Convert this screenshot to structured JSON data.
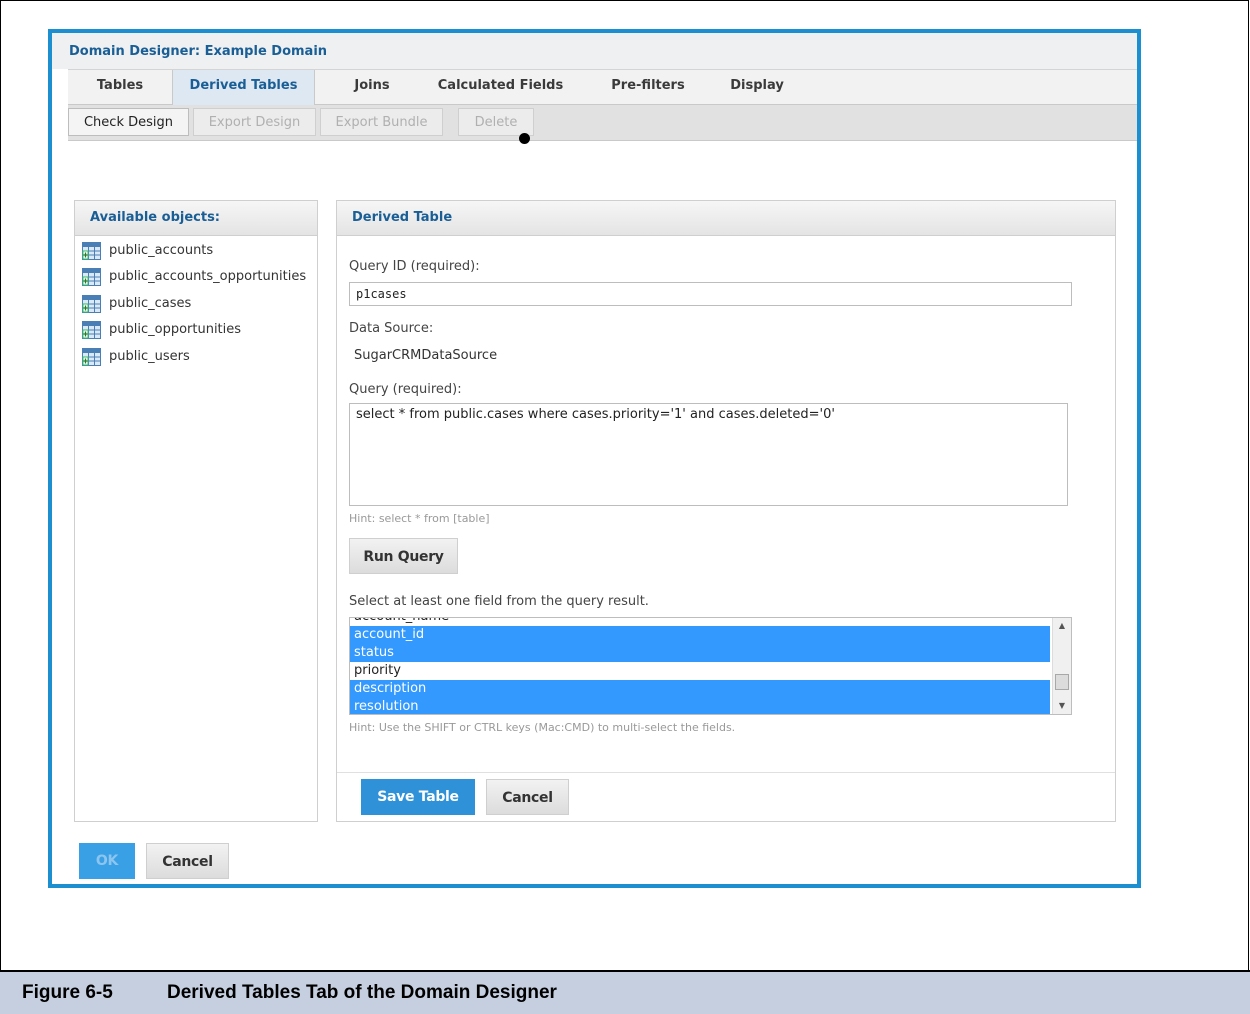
{
  "dialog": {
    "title": "Domain Designer: Example Domain"
  },
  "tabs": [
    {
      "label": "Tables"
    },
    {
      "label": "Derived Tables"
    },
    {
      "label": "Joins"
    },
    {
      "label": "Calculated Fields"
    },
    {
      "label": "Pre-filters"
    },
    {
      "label": "Display"
    }
  ],
  "active_tab": "Derived Tables",
  "toolbar": {
    "check_design": "Check Design",
    "export_design": "Export Design",
    "export_bundle": "Export Bundle",
    "delete": "Delete"
  },
  "available_objects": {
    "header": "Available objects:",
    "items": [
      "public_accounts",
      "public_accounts_opportunities",
      "public_cases",
      "public_opportunities",
      "public_users"
    ]
  },
  "derived_table": {
    "header": "Derived Table",
    "query_id_label": "Query ID (required):",
    "query_id_value": "p1cases",
    "data_source_label": "Data Source:",
    "data_source_value": "SugarCRMDataSource",
    "query_label": "Query (required):",
    "query_value": "select * from public.cases where cases.priority='1' and cases.deleted='0'",
    "query_hint": "Hint: select * from [table]",
    "run_query": "Run Query",
    "select_label": "Select at least one field from the query result.",
    "fields": [
      {
        "name": "account_name",
        "selected": false
      },
      {
        "name": "account_id",
        "selected": true
      },
      {
        "name": "status",
        "selected": true
      },
      {
        "name": "priority",
        "selected": false
      },
      {
        "name": "description",
        "selected": true
      },
      {
        "name": "resolution",
        "selected": true
      }
    ],
    "multi_hint": "Hint: Use the SHIFT or CTRL keys (Mac:CMD) to multi-select the fields.",
    "save_table": "Save Table",
    "cancel": "Cancel"
  },
  "footer": {
    "ok": "OK",
    "cancel": "Cancel"
  },
  "caption": {
    "number": "Figure 6-5",
    "title": "Derived Tables Tab of the Domain Designer"
  },
  "colors": {
    "accent": "#1c8fd1",
    "selection": "#3399ff",
    "header_text": "#1a5e96"
  }
}
